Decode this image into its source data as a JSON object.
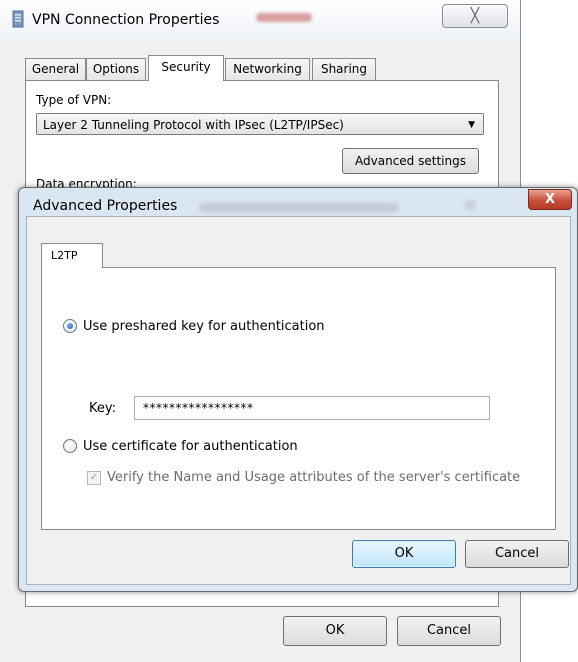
{
  "vpn_window": {
    "title": "VPN Connection Properties",
    "close_glyph": "╳",
    "tabs": [
      {
        "label": "General"
      },
      {
        "label": "Options"
      },
      {
        "label": "Security"
      },
      {
        "label": "Networking"
      },
      {
        "label": "Sharing"
      }
    ],
    "active_tab": "Security",
    "type_of_vpn_label": "Type of VPN:",
    "type_of_vpn_value": "Layer 2 Tunneling Protocol with IPsec (L2TP/IPSec)",
    "advanced_settings_label": "Advanced settings",
    "data_encryption_label": "Data encryption:",
    "ok_label": "OK",
    "cancel_label": "Cancel"
  },
  "advanced_dialog": {
    "title": "Advanced Properties",
    "close_glyph": "X",
    "tab_label": "L2TP",
    "preshared_key_option": {
      "label": "Use preshared key for authentication",
      "checked": true
    },
    "key_label": "Key:",
    "key_value": "*****************",
    "certificate_option": {
      "label": "Use certificate for authentication",
      "checked": false
    },
    "verify_checkbox": {
      "label": "Verify the Name and Usage attributes of the server's certificate",
      "checked": true,
      "enabled": false
    },
    "ok_label": "OK",
    "cancel_label": "Cancel"
  },
  "icons": {
    "app_icon": "network-connection-icon",
    "dropdown_icon": "chevron-down-icon"
  }
}
